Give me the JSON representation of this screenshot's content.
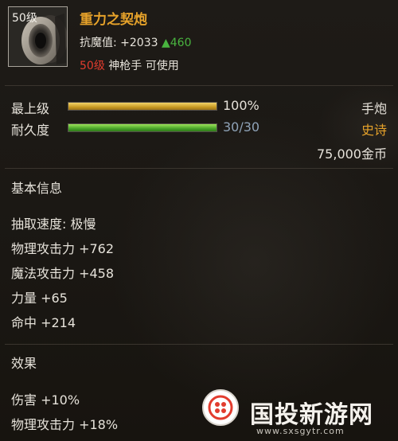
{
  "item": {
    "level_badge": "50级",
    "name": "重力之契炮",
    "resist_label": "抗魔值:",
    "resist_value": "+2033",
    "resist_up": "▲460",
    "req_level": "50级",
    "req_text": "神枪手 可使用"
  },
  "bars": {
    "top_label": "最上级",
    "top_value": "100%",
    "top_fraction": 1.0,
    "dur_label": "耐久度",
    "dur_value": "30/30",
    "dur_fraction": 1.0
  },
  "right": {
    "type": "手炮",
    "rarity": "史诗",
    "price": "75,000金币"
  },
  "basic": {
    "title": "基本信息",
    "lines": [
      "抽取速度: 极慢",
      "物理攻击力 +762",
      "魔法攻击力 +458",
      "力量 +65",
      "命中 +214"
    ]
  },
  "effect": {
    "title": "效果",
    "lines": [
      "伤害 +10%",
      "物理攻击力 +18%"
    ]
  },
  "watermark": {
    "text": "国投新游网",
    "url": "www.sxsgytr.com"
  },
  "colors": {
    "name": "#e6a22a",
    "up": "#49b43f",
    "level_red": "#e23c2e",
    "rarity": "#e6a22a",
    "bar_text": "#8fa3b8"
  }
}
